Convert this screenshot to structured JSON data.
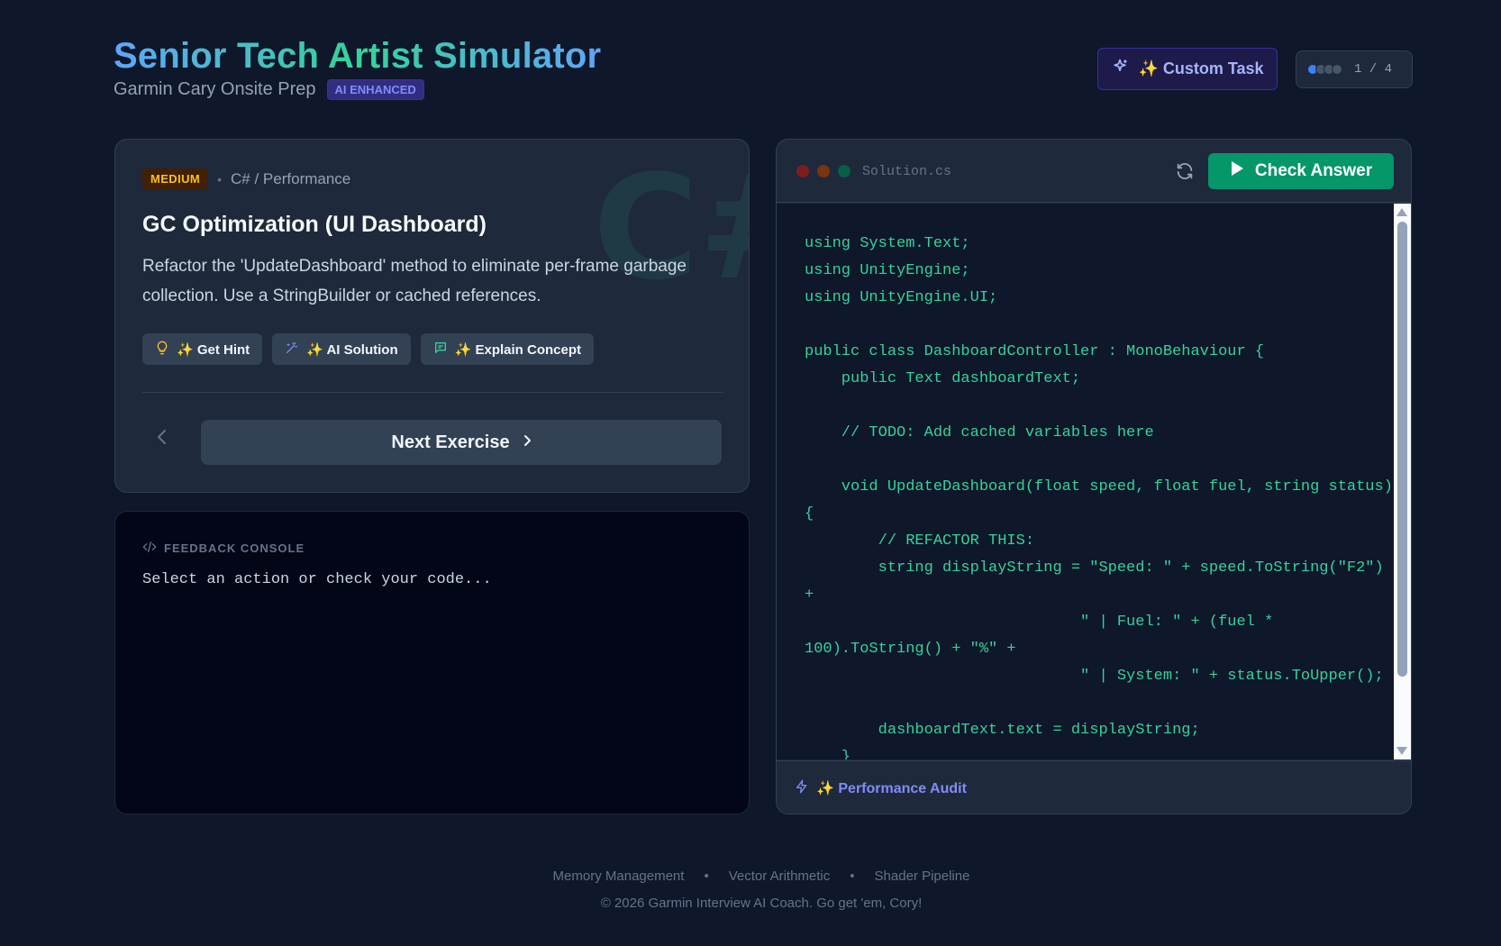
{
  "header": {
    "title": "Senior Tech Artist Simulator",
    "subtitle": "Garmin Cary Onsite Prep",
    "badge": "AI ENHANCED",
    "custom_task_label": "✨ Custom Task",
    "progress": {
      "current": 1,
      "total": 4,
      "text": "1 / 4"
    }
  },
  "task": {
    "difficulty": "MEDIUM",
    "category": "C# / Performance",
    "title": "GC Optimization (UI Dashboard)",
    "description": "Refactor the 'UpdateDashboard' method to eliminate per-frame garbage collection. Use a StringBuilder or cached references.",
    "bg_glyph": "C#",
    "actions": [
      {
        "label": "✨ Get Hint",
        "icon": "lightbulb-icon"
      },
      {
        "label": "✨ AI Solution",
        "icon": "magic-wand-icon"
      },
      {
        "label": "✨ Explain Concept",
        "icon": "message-icon"
      }
    ],
    "next_label": "Next Exercise"
  },
  "console": {
    "title": "FEEDBACK CONSOLE",
    "text": "Select an action or check your code..."
  },
  "editor": {
    "filename": "Solution.cs",
    "check_label": "Check Answer",
    "code": "using System.Text;\nusing UnityEngine;\nusing UnityEngine.UI;\n\npublic class DashboardController : MonoBehaviour {\n    public Text dashboardText;\n\n    // TODO: Add cached variables here\n\n    void UpdateDashboard(float speed, float fuel, string status)\n{\n        // REFACTOR THIS:\n        string displayString = \"Speed: \" + speed.ToString(\"F2\")\n+\n                              \" | Fuel: \" + (fuel *\n100).ToString() + \"%\" +\n                              \" | System: \" + status.ToUpper();\n\n        dashboardText.text = displayString;\n    }",
    "footer_label": "✨ Performance Audit",
    "colors": {
      "run": "#059669",
      "code": "#34d399"
    }
  },
  "footer": {
    "links": [
      "Memory Management",
      "Vector Arithmetic",
      "Shader Pipeline"
    ],
    "separator": "•",
    "copyright": "© 2026 Garmin Interview AI Coach. Go get 'em, Cory!"
  }
}
